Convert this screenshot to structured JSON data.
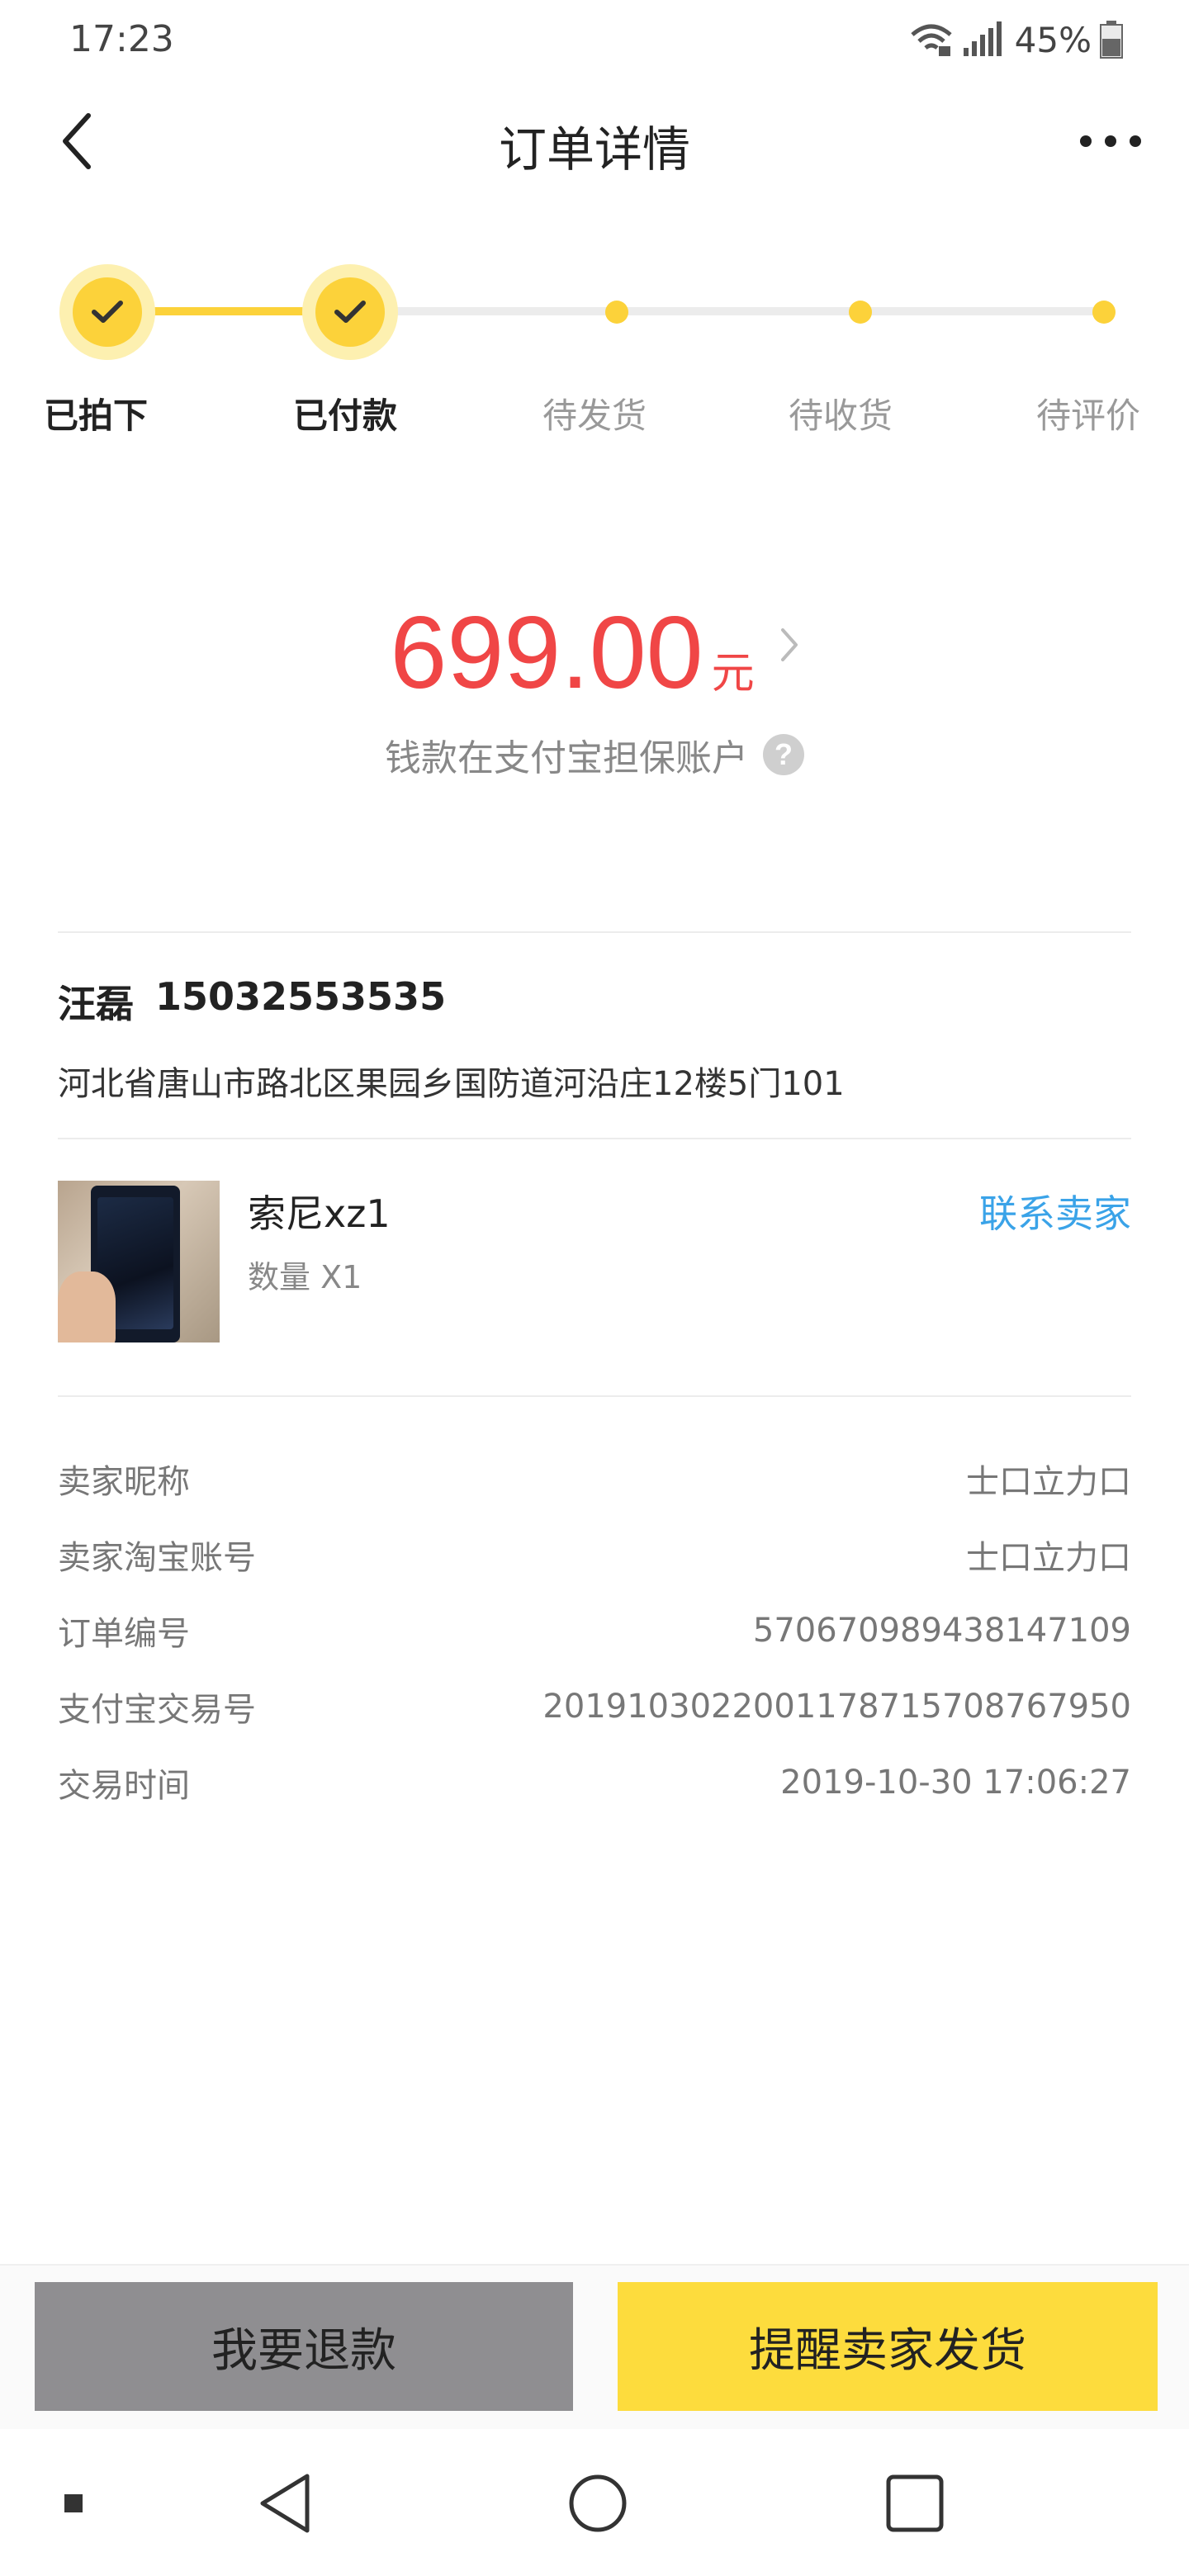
{
  "status_bar": {
    "time": "17:23",
    "battery_percent": "45%",
    "icons": [
      "wifi-icon",
      "signal-icon",
      "battery-icon"
    ]
  },
  "nav": {
    "title": "订单详情",
    "back_icon": "chevron-left-icon",
    "more_icon": "more-dots-icon"
  },
  "progress": {
    "steps": [
      {
        "label": "已拍下",
        "done": true
      },
      {
        "label": "已付款",
        "done": true
      },
      {
        "label": "待发货",
        "done": false
      },
      {
        "label": "待收货",
        "done": false
      },
      {
        "label": "待评价",
        "done": false
      }
    ],
    "accent_color": "#fcd23a"
  },
  "amount": {
    "value": "699.00",
    "unit": "元",
    "escrow_text": "钱款在支付宝担保账户",
    "help_glyph": "?",
    "color": "#f04646"
  },
  "address": {
    "name": "汪磊",
    "phone": "15032553535",
    "detail": "河北省唐山市路北区果园乡国防道河沿庄12楼5门101"
  },
  "product": {
    "name": "索尼xz1",
    "quantity": "数量 X1",
    "contact_label": "联系卖家"
  },
  "info_rows": [
    {
      "label": "卖家昵称",
      "value": "士口立力口"
    },
    {
      "label": "卖家淘宝账号",
      "value": "士口立力口"
    },
    {
      "label": "订单编号",
      "value": "570670989438147109"
    },
    {
      "label": "支付宝交易号",
      "value": "2019103022001178715708767950"
    },
    {
      "label": "交易时间",
      "value": "2019-10-30 17:06:27"
    }
  ],
  "actions": {
    "refund_label": "我要退款",
    "remind_label": "提醒卖家发货"
  },
  "system_nav": [
    "square-small-icon",
    "back-triangle-icon",
    "home-circle-icon",
    "recents-square-icon"
  ]
}
